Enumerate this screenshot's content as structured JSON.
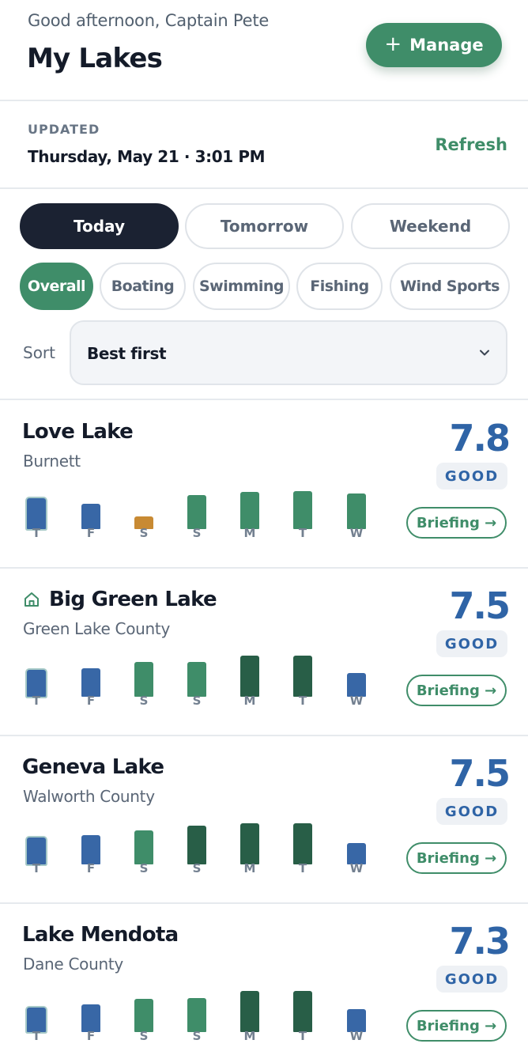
{
  "header": {
    "greeting": "Good afternoon, Captain Pete",
    "title": "My Lakes",
    "manage_label": "Manage"
  },
  "updated": {
    "label": "UPDATED",
    "time": "Thursday, May 21 · 3:01 PM",
    "refresh_label": "Refresh"
  },
  "day_tabs": [
    {
      "label": "Today",
      "active": true
    },
    {
      "label": "Tomorrow",
      "active": false
    },
    {
      "label": "Weekend",
      "active": false
    }
  ],
  "activity_tabs": [
    {
      "label": "Overall",
      "active": true
    },
    {
      "label": "Boating",
      "active": false
    },
    {
      "label": "Swimming",
      "active": false
    },
    {
      "label": "Fishing",
      "active": false
    },
    {
      "label": "Wind Sports",
      "active": false
    }
  ],
  "sort": {
    "label": "Sort",
    "value": "Best first"
  },
  "colors": {
    "accent_green": "#3f8d69",
    "dark_green": "#285e47",
    "blue": "#3867a6",
    "orange": "#c88a33",
    "navy": "#1b2232"
  },
  "week_days": [
    "T",
    "F",
    "S",
    "S",
    "M",
    "T",
    "W"
  ],
  "lakes": [
    {
      "name": "Love Lake",
      "county": "Burnett",
      "score": "7.8",
      "rating": "GOOD",
      "home": false,
      "briefing_label": "Briefing →",
      "forecast": [
        {
          "level": 0.75,
          "color": "#3867a6"
        },
        {
          "level": 0.62,
          "color": "#3867a6"
        },
        {
          "level": 0.3,
          "color": "#c88a33"
        },
        {
          "level": 0.82,
          "color": "#3f8d69"
        },
        {
          "level": 0.9,
          "color": "#3f8d69"
        },
        {
          "level": 0.92,
          "color": "#3f8d69"
        },
        {
          "level": 0.86,
          "color": "#3f8d69"
        }
      ]
    },
    {
      "name": "Big Green Lake",
      "county": "Green Lake County",
      "score": "7.5",
      "rating": "GOOD",
      "home": true,
      "briefing_label": "Briefing →",
      "forecast": [
        {
          "level": 0.65,
          "color": "#3867a6"
        },
        {
          "level": 0.7,
          "color": "#3867a6"
        },
        {
          "level": 0.85,
          "color": "#3f8d69"
        },
        {
          "level": 0.85,
          "color": "#3f8d69"
        },
        {
          "level": 1.0,
          "color": "#285e47"
        },
        {
          "level": 1.0,
          "color": "#285e47"
        },
        {
          "level": 0.58,
          "color": "#3867a6"
        }
      ]
    },
    {
      "name": "Geneva Lake",
      "county": "Walworth County",
      "score": "7.5",
      "rating": "GOOD",
      "home": false,
      "briefing_label": "Briefing →",
      "forecast": [
        {
          "level": 0.65,
          "color": "#3867a6"
        },
        {
          "level": 0.72,
          "color": "#3867a6"
        },
        {
          "level": 0.82,
          "color": "#3f8d69"
        },
        {
          "level": 0.94,
          "color": "#285e47"
        },
        {
          "level": 1.0,
          "color": "#285e47"
        },
        {
          "level": 1.0,
          "color": "#285e47"
        },
        {
          "level": 0.52,
          "color": "#3867a6"
        }
      ]
    },
    {
      "name": "Lake Mendota",
      "county": "Dane County",
      "score": "7.3",
      "rating": "GOOD",
      "home": false,
      "briefing_label": "Briefing →",
      "forecast": [
        {
          "level": 0.6,
          "color": "#3867a6"
        },
        {
          "level": 0.68,
          "color": "#3867a6"
        },
        {
          "level": 0.8,
          "color": "#3f8d69"
        },
        {
          "level": 0.82,
          "color": "#3f8d69"
        },
        {
          "level": 1.0,
          "color": "#285e47"
        },
        {
          "level": 1.0,
          "color": "#285e47"
        },
        {
          "level": 0.55,
          "color": "#3867a6"
        }
      ]
    }
  ]
}
